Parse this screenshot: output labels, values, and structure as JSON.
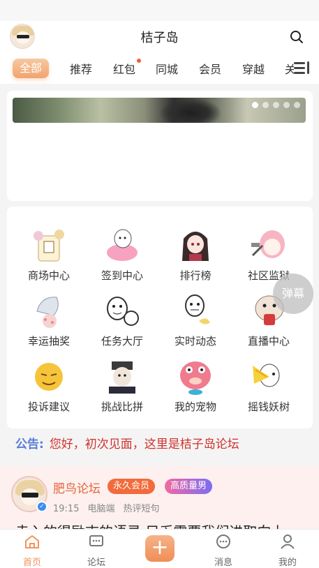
{
  "header": {
    "title": "桔子岛"
  },
  "tabs": [
    {
      "label": "全部",
      "active": true
    },
    {
      "label": "推荐"
    },
    {
      "label": "红包",
      "dot": true
    },
    {
      "label": "同城"
    },
    {
      "label": "会员"
    },
    {
      "label": "穿越"
    },
    {
      "label": "关"
    }
  ],
  "banner": {
    "dots": 5,
    "active_dot": 0
  },
  "grid": [
    {
      "label": "商场中心",
      "icon": "mall-icon"
    },
    {
      "label": "签到中心",
      "icon": "checkin-icon"
    },
    {
      "label": "排行榜",
      "icon": "ranking-icon"
    },
    {
      "label": "社区监狱",
      "icon": "prison-icon"
    },
    {
      "label": "幸运抽奖",
      "icon": "lottery-icon"
    },
    {
      "label": "任务大厅",
      "icon": "task-icon"
    },
    {
      "label": "实时动态",
      "icon": "feed-icon"
    },
    {
      "label": "直播中心",
      "icon": "live-icon"
    },
    {
      "label": "投诉建议",
      "icon": "feedback-icon"
    },
    {
      "label": "挑战比拼",
      "icon": "challenge-icon"
    },
    {
      "label": "我的宠物",
      "icon": "pet-icon"
    },
    {
      "label": "摇钱妖树",
      "icon": "money-tree-icon"
    }
  ],
  "danmu": "弹幕",
  "notice": {
    "label": "公告:",
    "text": "您好，初次见面，这里是桔子岛论坛"
  },
  "post": {
    "author": "肥鸟论坛",
    "badges": [
      "永久会员",
      "高质量男"
    ],
    "time": "19:15",
    "device": "电脑端",
    "tag": "热评短句",
    "text": "走入的得励志的语录 只乏需要我们进取向上"
  },
  "bottom_nav": [
    {
      "label": "首页",
      "active": true
    },
    {
      "label": "论坛"
    },
    {
      "label": ""
    },
    {
      "label": "消息"
    },
    {
      "label": "我的"
    }
  ],
  "colors": {
    "accent": "#f1935a",
    "notice_label": "#5a7bd8",
    "notice_text": "#d0312d"
  }
}
